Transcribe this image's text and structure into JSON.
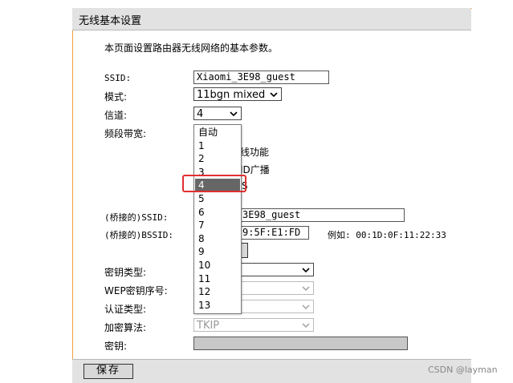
{
  "panel": {
    "title": "无线基本设置",
    "description": "本页面设置路由器无线网络的基本参数。"
  },
  "labels": {
    "ssid": "SSID:",
    "mode": "模式:",
    "channel": "信道:",
    "bandwidth": "频段带宽:",
    "bridge_ssid": "(桥接的)SSID:",
    "bridge_bssid": "(桥接的)BSSID:",
    "key_type": "密钥类型:",
    "wep_index": "WEP密钥序号:",
    "auth_type": "认证类型:",
    "encryption": "加密算法:",
    "key": "密钥:"
  },
  "fields": {
    "ssid_value": "Xiaomi_3E98_guest",
    "mode_value": "11bgn mixed",
    "channel_value": "4",
    "bridge_ssid_partial": "3E98_guest",
    "bridge_bssid_partial": "9:5F:E1:FD",
    "bssid_example": "例如: 00:1D:0F:11:22:33",
    "encryption_value": "TKIP"
  },
  "partial_options": {
    "wireless_function": "线功能",
    "ssid_broadcast": "ID广播",
    "wds_fragment": "S"
  },
  "channel_options": [
    "自动",
    "1",
    "2",
    "3",
    "4",
    "5",
    "6",
    "7",
    "8",
    "9",
    "10",
    "11",
    "12",
    "13"
  ],
  "channel_selected": "4",
  "buttons": {
    "save": "保存"
  },
  "watermark": "CSDN @layman",
  "colors": {
    "panel_border": "#f0a040",
    "highlight": "#e03030",
    "selected_option": "#666666"
  }
}
